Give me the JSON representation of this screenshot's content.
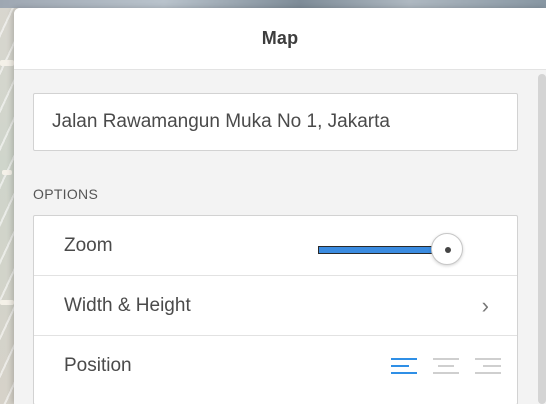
{
  "panel": {
    "title": "Map"
  },
  "address": {
    "value": "Jalan Rawamangun Muka No 1, Jakarta"
  },
  "options": {
    "section_label": "OPTIONS",
    "zoom": {
      "label": "Zoom",
      "level_fraction": 0.92
    },
    "width_height": {
      "label": "Width & Height",
      "chevron": "›"
    },
    "position": {
      "label": "Position",
      "alignments": [
        "left",
        "center",
        "right"
      ],
      "selected": "left"
    }
  },
  "colors": {
    "accent": "#2f8fe6",
    "slider_fill": "#3a8be0",
    "panel_bg": "#f3f3f3"
  },
  "icons": {
    "chevron": "chevron-right-icon",
    "align_left": "align-left-icon",
    "align_center": "align-center-icon",
    "align_right": "align-right-icon"
  }
}
